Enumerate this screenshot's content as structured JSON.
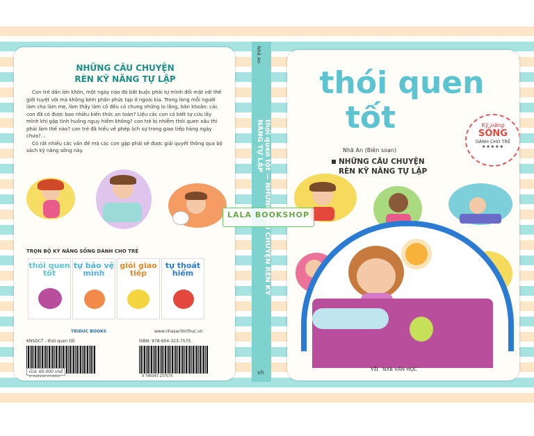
{
  "back_cover": {
    "title_line1": "NHỮNG CÂU CHUYỆN",
    "title_line2": "RÈN KỸ NĂNG TỰ LẬP",
    "paragraph1": "Con trẻ dần lớn khôn, một ngày nào đó bắt buộc phải tự mình đối mặt với thế giới tuyệt vời mà không kém phần phức tạp ở ngoài kia. Trong lòng mỗi người làm cha làm mẹ, làm thầy làm cô đều có chung những lo lắng, băn khoăn: các con đã có được bao nhiêu kiến thức an toàn? Liệu các con có biết tự cứu lấy mình khi gặp tình huống nguy hiểm không? con trẻ bị nhiễm thói quen xấu thì phải làm thế nào? con trẻ đã hiểu về phép lịch sự trong giao tiếp hàng ngày chưa?...",
    "paragraph2": "Có rất nhiều các vấn đề mà các con gặp phải sẽ được giải quyết thông qua bộ sách kỹ năng sống này.",
    "series_heading": "TRỌN BỘ KỸ NĂNG SỐNG DÀNH CHO TRẺ",
    "series_books": [
      {
        "title": "thói quen tốt",
        "color": "#5cc3d1"
      },
      {
        "title": "tự bảo vệ mình",
        "color": "#4fb0e0"
      },
      {
        "title": "giỏi giao tiếp",
        "color": "#e08a2c"
      },
      {
        "title": "tự thoát hiểm",
        "color": "#2b7bd3"
      }
    ],
    "code_label": "KNSDCT - thói quen tốt",
    "isbn": "ISBN: 978-604-323-7575",
    "barcode_digits_left": "8 936109 870083",
    "barcode_digits_right": "9 786043 237575",
    "price": "Giá: 60.000 vnđ",
    "publisher_small": "TRIDUC BOOKS",
    "website": "www.nhasachtrilhuc.vn"
  },
  "spine": {
    "author": "Nhã An",
    "title": "thói quen tốt — NHỮNG CÂU CHUYỆN RÈN KỸ NĂNG TỰ LẬP",
    "publisher_mark": "vh"
  },
  "front_cover": {
    "title_line1": "thói quen",
    "title_line2": "tốt",
    "badge": {
      "line1": "Kỹ năng",
      "line2": "SỐNG",
      "line3": "DÀNH CHO TRẺ",
      "stars": "★★★★★"
    },
    "author": "Nhã An (Biên soạn)",
    "subtitle_line1": "NHỮNG CÂU CHUYỆN",
    "subtitle_line2": "RÈN KỸ NĂNG TỰ LẬP",
    "publisher": "NXB VĂN HỌC",
    "publisher_mark": "vh"
  },
  "watermark": "LALA BOOKSHOP",
  "colors": {
    "teal": "#5cc3d1",
    "stripe_peach": "#fbe7c8",
    "stripe_teal": "#a7e3e0",
    "bed": "#b94e9c",
    "headboard": "#2b7bd3"
  }
}
